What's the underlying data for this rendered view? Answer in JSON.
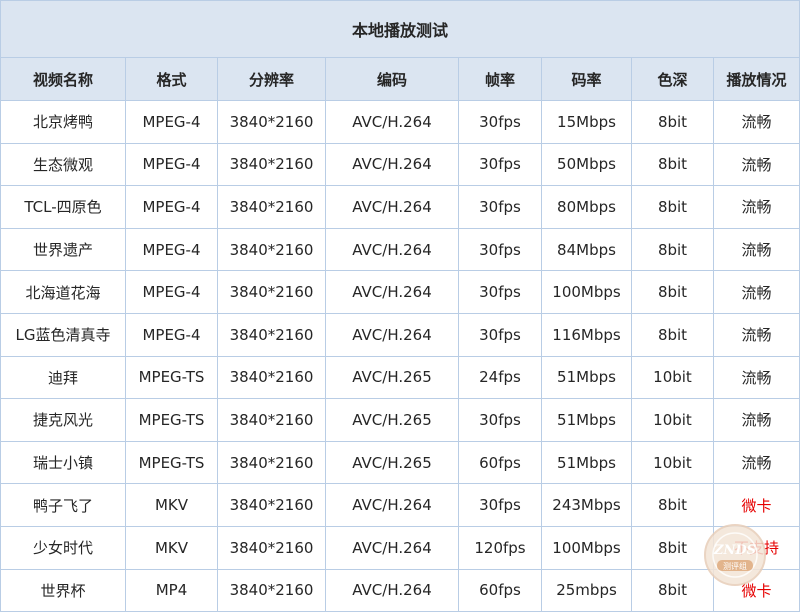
{
  "title": "本地播放测试",
  "columns": [
    "视频名称",
    "格式",
    "分辨率",
    "编码",
    "帧率",
    "码率",
    "色深",
    "播放情况"
  ],
  "rows": [
    {
      "name": "北京烤鸭",
      "format": "MPEG-4",
      "resolution": "3840*2160",
      "codec": "AVC/H.264",
      "fps": "30fps",
      "bitrate": "15Mbps",
      "depth": "8bit",
      "status": "流畅",
      "status_type": "ok"
    },
    {
      "name": "生态微观",
      "format": "MPEG-4",
      "resolution": "3840*2160",
      "codec": "AVC/H.264",
      "fps": "30fps",
      "bitrate": "50Mbps",
      "depth": "8bit",
      "status": "流畅",
      "status_type": "ok"
    },
    {
      "name": "TCL-四原色",
      "format": "MPEG-4",
      "resolution": "3840*2160",
      "codec": "AVC/H.264",
      "fps": "30fps",
      "bitrate": "80Mbps",
      "depth": "8bit",
      "status": "流畅",
      "status_type": "ok"
    },
    {
      "name": "世界遗产",
      "format": "MPEG-4",
      "resolution": "3840*2160",
      "codec": "AVC/H.264",
      "fps": "30fps",
      "bitrate": "84Mbps",
      "depth": "8bit",
      "status": "流畅",
      "status_type": "ok"
    },
    {
      "name": "北海道花海",
      "format": "MPEG-4",
      "resolution": "3840*2160",
      "codec": "AVC/H.264",
      "fps": "30fps",
      "bitrate": "100Mbps",
      "depth": "8bit",
      "status": "流畅",
      "status_type": "ok"
    },
    {
      "name": "LG蓝色清真寺",
      "format": "MPEG-4",
      "resolution": "3840*2160",
      "codec": "AVC/H.264",
      "fps": "30fps",
      "bitrate": "116Mbps",
      "depth": "8bit",
      "status": "流畅",
      "status_type": "ok"
    },
    {
      "name": "迪拜",
      "format": "MPEG-TS",
      "resolution": "3840*2160",
      "codec": "AVC/H.265",
      "fps": "24fps",
      "bitrate": "51Mbps",
      "depth": "10bit",
      "status": "流畅",
      "status_type": "ok"
    },
    {
      "name": "捷克风光",
      "format": "MPEG-TS",
      "resolution": "3840*2160",
      "codec": "AVC/H.265",
      "fps": "30fps",
      "bitrate": "51Mbps",
      "depth": "10bit",
      "status": "流畅",
      "status_type": "ok"
    },
    {
      "name": "瑞士小镇",
      "format": "MPEG-TS",
      "resolution": "3840*2160",
      "codec": "AVC/H.265",
      "fps": "60fps",
      "bitrate": "51Mbps",
      "depth": "10bit",
      "status": "流畅",
      "status_type": "ok"
    },
    {
      "name": "鸭子飞了",
      "format": "MKV",
      "resolution": "3840*2160",
      "codec": "AVC/H.264",
      "fps": "30fps",
      "bitrate": "243Mbps",
      "depth": "8bit",
      "status": "微卡",
      "status_type": "bad"
    },
    {
      "name": "少女时代",
      "format": "MKV",
      "resolution": "3840*2160",
      "codec": "AVC/H.264",
      "fps": "120fps",
      "bitrate": "100Mbps",
      "depth": "8bit",
      "status": "不支持",
      "status_type": "bad"
    },
    {
      "name": "世界杯",
      "format": "MP4",
      "resolution": "3840*2160",
      "codec": "AVC/H.264",
      "fps": "60fps",
      "bitrate": "25mbps",
      "depth": "8bit",
      "status": "微卡",
      "status_type": "bad"
    }
  ],
  "watermark": {
    "text_top": "ZNDS",
    "text_bottom": "测评组"
  },
  "colors": {
    "header_bg": "#dbe5f1",
    "border": "#b9cde5",
    "text": "#262626",
    "status_bad": "#e60000",
    "watermark_ring": "#e7cdb8"
  }
}
